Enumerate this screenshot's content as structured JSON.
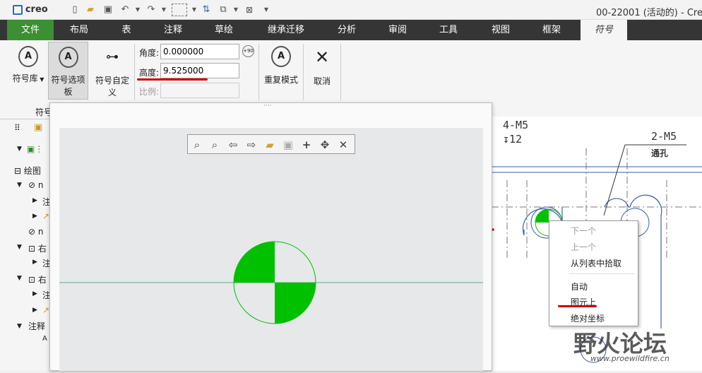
{
  "titlebar": {
    "app_logo": "creo",
    "title": "00-22001 (活动的) - Cre"
  },
  "menubar": {
    "tabs": [
      "文件",
      "布局",
      "表",
      "注释",
      "草绘",
      "继承迁移",
      "分析",
      "审阅",
      "工具",
      "视图",
      "框架",
      "符号"
    ]
  },
  "ribbon": {
    "symbol_library": "符号库",
    "symbol_options_line1": "符号选项",
    "symbol_options_line2": "板",
    "symbol_custom_line1": "符号自定",
    "symbol_custom_line2": "义",
    "angle_label": "角度:",
    "angle_value": "0.000000",
    "height_label": "高度:",
    "height_value": "9.525000",
    "scale_label": "比例:",
    "scale_value": "",
    "repeat_mode": "重复模式",
    "cancel": "取消",
    "group_label": "符号",
    "rotate_badge": "+90"
  },
  "tree": {
    "drawing": "绘图",
    "item_n": "n",
    "item_note": "注",
    "item_right": "右",
    "annotation": "注释"
  },
  "dialog": {
    "grip": "····"
  },
  "drawing": {
    "note_top_1": "4-M5",
    "note_top_2": "↧12",
    "note_right_1": "2-M5",
    "note_right_2": "通孔"
  },
  "context_menu": {
    "items": [
      "下一个",
      "上一个",
      "从列表中拾取",
      "自动",
      "图元上",
      "绝对坐标"
    ]
  },
  "watermark": {
    "text": "野火论坛",
    "url": "www.proewildfire.cn"
  },
  "colors": {
    "accent_green": "#00c000",
    "menubar_bg": "#353535",
    "file_tab": "#3c8f32",
    "annotation_red": "#cc0000"
  }
}
